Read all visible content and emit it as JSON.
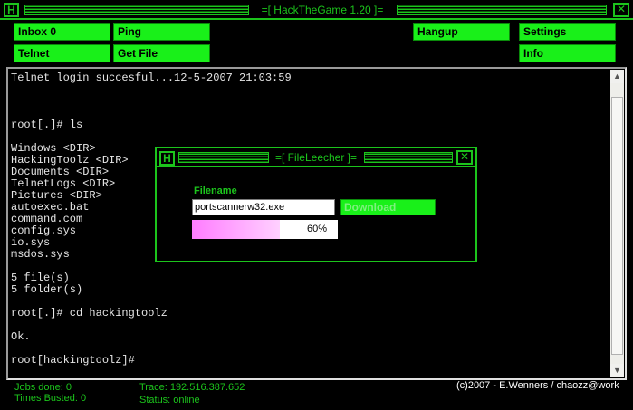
{
  "window": {
    "title": "=[ HackTheGame 1.20 ]=",
    "logo_letter": "H",
    "close_glyph": "✕"
  },
  "toolbar": {
    "inbox": "Inbox 0",
    "ping": "Ping",
    "telnet": "Telnet",
    "get_file": "Get File",
    "hangup": "Hangup",
    "settings": "Settings",
    "info": "Info"
  },
  "terminal": {
    "lines": [
      "Telnet login succesful...12-5-2007 21:03:59",
      "",
      "",
      "",
      "root[.]# ls",
      "",
      "Windows <DIR>",
      "HackingToolz <DIR>",
      "Documents <DIR>",
      "TelnetLogs <DIR>",
      "Pictures <DIR>",
      "autoexec.bat",
      "command.com",
      "config.sys",
      "io.sys",
      "msdos.sys",
      "",
      "5 file(s)",
      "5 folder(s)",
      "",
      "root[.]# cd hackingtoolz",
      "",
      "Ok.",
      "",
      "root[hackingtoolz]#"
    ]
  },
  "status": {
    "jobs_done": "Jobs done: 0",
    "times_busted": "Times Busted: 0",
    "trace": "Trace: 192.516.387.652",
    "status": "Status: online",
    "copyright": "(c)2007 - E.Wenners / chaozz@work"
  },
  "dialog": {
    "title": "=[ FileLeecher ]=",
    "logo_letter": "H",
    "close_glyph": "✕",
    "filename_label": "Filename",
    "filename_value": "portscannerw32.exe",
    "download_label": "Download",
    "progress_percent": 60,
    "progress_label": "60%"
  },
  "colors": {
    "accent": "#1cc41c",
    "button": "#19f019",
    "progress": "#ff7dff",
    "terminal_text": "#e6e6e6"
  },
  "icons": {
    "scroll_up": "▲",
    "scroll_down": "▼"
  }
}
